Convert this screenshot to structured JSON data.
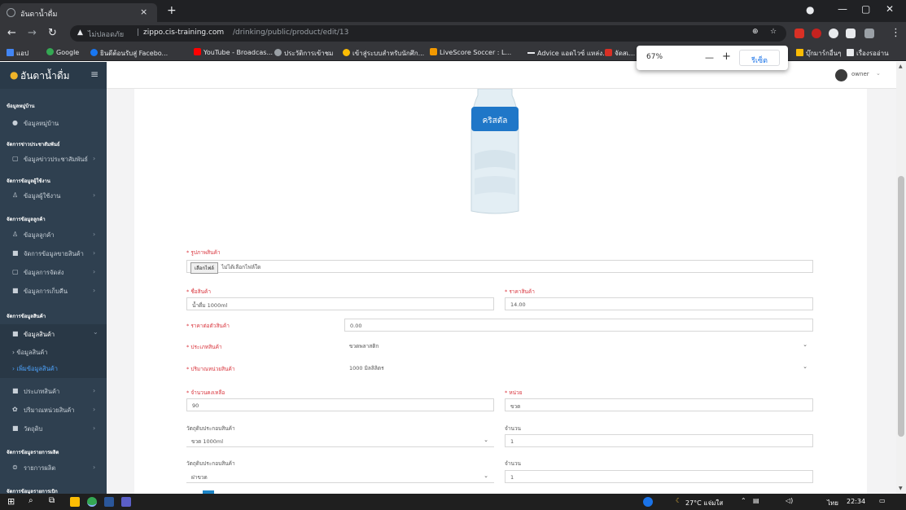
{
  "browser": {
    "tab_title": "อันดาน้ำดื่ม",
    "security_label": "ไม่ปลอดภัย",
    "url_host": "zippo.cis-training.com",
    "url_path": "/drinking/public/product/edit/13",
    "bookmarks": [
      {
        "label": "แอป",
        "color": "#4285f4"
      },
      {
        "label": "Google",
        "color": "#34a853"
      },
      {
        "label": "ยินดีต้อนรับสู่ Facebo...",
        "color": "#1877f2"
      },
      {
        "label": "YouTube - Broadcas...",
        "color": "#ff0000"
      },
      {
        "label": "ประวัติการเข้าชม",
        "color": "#9aa0a6"
      },
      {
        "label": "เข้าสู่ระบบสำหรับนักศึก...",
        "color": "#fbbc04"
      },
      {
        "label": "LiveScore Soccer : L...",
        "color": "#f29900"
      },
      {
        "label": "Advice แอดไวซ์ แหล่ง...",
        "color": "#e8eaed"
      },
      {
        "label": "จัดสเ...",
        "color": "#d93025"
      }
    ],
    "bookmarks_right": [
      "บุ๊กมาร์กอื่นๆ",
      "เรื่องรออ่าน"
    ],
    "zoom": {
      "level": "67%",
      "minus": "—",
      "plus": "+",
      "reset": "รีเซ็ต"
    }
  },
  "app": {
    "brand": "อันดาน้ำดื่ม",
    "user": "owner"
  },
  "sidebar": {
    "sections": [
      {
        "heading": "ข้อมูลหมู่บ้าน",
        "items": [
          {
            "icon": "●",
            "label": "ข้อมูลหมู่บ้าน",
            "chev": ""
          }
        ]
      },
      {
        "heading": "จัดการข่าวประชาสัมพันธ์",
        "items": [
          {
            "icon": "▢",
            "label": "ข้อมูลข่าวประชาสัมพันธ์",
            "chev": "›"
          }
        ]
      },
      {
        "heading": "จัดการข้อมูลผู้ใช้งาน",
        "items": [
          {
            "icon": "♙",
            "label": "ข้อมูลผู้ใช้งาน",
            "chev": "›"
          }
        ]
      },
      {
        "heading": "จัดการข้อมูลลูกค้า",
        "items": [
          {
            "icon": "♙",
            "label": "ข้อมูลลูกค้า",
            "chev": "›"
          },
          {
            "icon": "■",
            "label": "จัดการข้อมูลขายสินค้า",
            "chev": "›"
          },
          {
            "icon": "▢",
            "label": "ข้อมูลการจัดส่ง",
            "chev": "›"
          },
          {
            "icon": "■",
            "label": "ข้อมูลการเก็บคืน",
            "chev": "›"
          }
        ]
      },
      {
        "heading": "จัดการข้อมูลสินค้า",
        "items": [
          {
            "icon": "■",
            "label": "ข้อมูลสินค้า",
            "chev": "⌄"
          }
        ]
      }
    ],
    "sub_items": [
      "› ข้อมูลสินค้า",
      "› เพิ่มข้อมูลสินค้า"
    ],
    "after_items": [
      {
        "icon": "■",
        "label": "ประเภทสินค้า",
        "chev": "›"
      },
      {
        "icon": "✿",
        "label": "ปริมาณหน่วยสินค้า",
        "chev": "›"
      },
      {
        "icon": "■",
        "label": "วัตถุดิบ",
        "chev": "›"
      }
    ],
    "section_prod": {
      "heading": "จัดการข้อมูลรายการผลิต",
      "item": {
        "icon": "⊜",
        "label": "รายการผลิต",
        "chev": "›"
      }
    },
    "section_last": "จัดการข้อมูลรายการเบิก"
  },
  "product_image_label": "คริสตัล",
  "form": {
    "image_label": "* รูปภาพสินค้า",
    "file_button": "เลือกไฟล์",
    "file_status": "ไม่ได้เลือกไฟล์ใด",
    "name_label": "* ชื่อสินค้า",
    "name_value": "น้ำดื่ม 1000ml",
    "price_label": "* ราคาสินค้า",
    "price_value": "14.00",
    "unit_price_label": "* ราคาต่อตัวสินค้า",
    "unit_price_value": "0.00",
    "type_label": "* ประเภทสินค้า",
    "type_value": "ขวดพลาสติก",
    "volume_label": "* ปริมาณหน่วยสินค้า",
    "volume_value": "1000 มิลลิลิตร",
    "stock_label": "* จำนวนคงเหลือ",
    "stock_value": "90",
    "unit_label": "* หน่วย",
    "unit_value": "ขวด",
    "material1_label": "วัตถุดิบประกอบสินค้า",
    "material1_value": "ขวด 1000ml",
    "qty1_label": "จำนวน",
    "qty1_value": "1",
    "material2_label": "วัตถุดิบประกอบสินค้า",
    "material2_value": "ฝาขวด",
    "qty2_label": "จำนวน",
    "qty2_value": "1"
  },
  "taskbar": {
    "weather": "27°C แจ่มใส",
    "lang": "ไทย",
    "time": "22:34"
  }
}
